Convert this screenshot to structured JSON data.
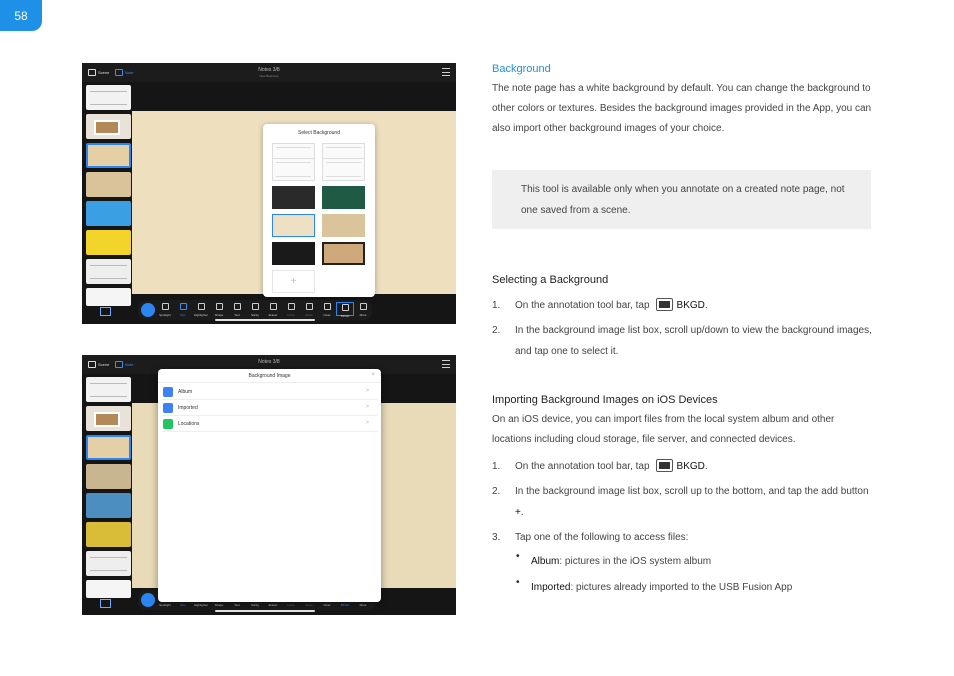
{
  "page_number": "58",
  "screenshot1": {
    "topbar": {
      "scene_label": "Scene",
      "note_label": "Note",
      "title": "Notes 3/8",
      "subtitle": "New Business"
    },
    "canvas_text": "busi",
    "popover": {
      "title": "Select Background",
      "add_symbol": "+"
    },
    "toolbar": [
      "Spotlight",
      "Pen",
      "Highlighter",
      "Shape",
      "Text",
      "Sticky",
      "Eraser",
      "Undo",
      "Redo",
      "Clear",
      "BKGD",
      "More"
    ]
  },
  "screenshot2": {
    "topbar": {
      "scene_label": "Scene",
      "note_label": "Note",
      "title": "Notes 3/8"
    },
    "dialog": {
      "title": "Background Image",
      "close": "×",
      "rows": [
        {
          "label": "Album",
          "color": "#3b82f6"
        },
        {
          "label": "Imported",
          "color": "#3b82f6"
        },
        {
          "label": "Locations",
          "color": "#22c55e"
        }
      ],
      "chevron": ">"
    },
    "toolbar": [
      "Spotlight",
      "Pen",
      "Highlighter",
      "Shape",
      "Text",
      "Sticky",
      "Eraser",
      "Undo",
      "Redo",
      "Clear",
      "BKGD",
      "More"
    ]
  },
  "background_section": {
    "heading": "Background",
    "paragraph": "The note page has a white background by default. You can change the background to other colors or textures. Besides the background images provided in the App, you can also import other background images of your choice.",
    "note": "This tool is available only when you annotate on a created note page, not one saved from a scene."
  },
  "selecting_section": {
    "heading": "Selecting a Background",
    "steps": [
      {
        "num": "1.",
        "before": "On the annotation tool bar, tap",
        "key": "BKGD",
        "after": "."
      },
      {
        "num": "2.",
        "text": "In the background image list box, scroll up/down to view the background images, and tap one to select it."
      }
    ]
  },
  "importing_section": {
    "heading": "Importing Background Images on iOS Devices",
    "intro": "On an iOS device, you can import files from the local system album and other locations including cloud storage, file server, and connected devices.",
    "steps": [
      {
        "num": "1.",
        "before": "On the annotation tool bar, tap",
        "key": "BKGD",
        "after": "."
      },
      {
        "num": "2.",
        "before": "In the background image list box, scroll up to the bottom, and tap the add button ",
        "key": "+",
        "after": "."
      },
      {
        "num": "3.",
        "text": "Tap one of the following to access files:"
      }
    ],
    "bullets": [
      {
        "term": "Album",
        "desc": ": pictures in the iOS system album"
      },
      {
        "term": "Imported",
        "desc": ": pictures already imported to the USB Fusion App"
      }
    ]
  }
}
